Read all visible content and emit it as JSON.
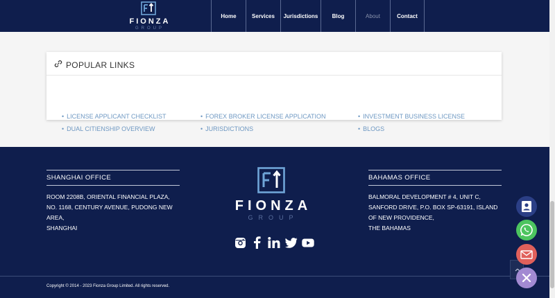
{
  "header": {
    "brand": "FIONZA",
    "brand_sub": "GROUP",
    "nav": [
      {
        "label": "Home"
      },
      {
        "label": "Services"
      },
      {
        "label": "Jurisdictions"
      },
      {
        "label": "Blog"
      },
      {
        "label": "About",
        "active": true
      },
      {
        "label": "Contact"
      }
    ]
  },
  "popular_links": {
    "title": "POPULAR LINKS",
    "icon": "link-icon",
    "items": [
      {
        "label": "LICENSE APPLICANT CHECKLIST"
      },
      {
        "label": "DUAL CITIENSHIP OVERVIEW"
      },
      {
        "label": "FOREX BROKER LICENSE APPLICATION"
      },
      {
        "label": "JURISDICTIONS"
      },
      {
        "label": "INVESTMENT BUSINESS LICENSE"
      },
      {
        "label": "BLOGS"
      }
    ]
  },
  "footer": {
    "shanghai": {
      "title": "SHANGHAI OFFICE",
      "lines": [
        "ROOM 2208B, ORIENTAL FINANCIAL PLAZA,",
        "NO. 1168, CENTURY AVENUE, PUDONG NEW",
        "AREA,",
        "SHANGHAI"
      ]
    },
    "bahamas": {
      "title": "BAHAMAS OFFICE",
      "lines": [
        "BALMORAL DEVELOPMENT # 4, UNIT C,",
        "SANFORD DRIVE, P.O. BOX SP-63191, ISLAND",
        "OF NEW PROVIDENCE,",
        "THE BAHAMAS"
      ]
    },
    "brand": "FIONZA",
    "brand_sub": "GROUP",
    "social": [
      "instagram-icon",
      "facebook-icon",
      "linkedin-icon",
      "twitter-icon",
      "youtube-icon"
    ],
    "copyright": "Copyright © 2014 - 2023 Fionza Group Limited. All rights reserved."
  },
  "floating_buttons": {
    "contact": {
      "icon": "contact-card-icon",
      "color": "#2b3f86"
    },
    "whatsapp": {
      "icon": "whatsapp-icon",
      "color": "#4cc45f"
    },
    "email": {
      "icon": "email-icon",
      "color": "#e0605b"
    },
    "close": {
      "icon": "close-icon",
      "color": "#a28ad2"
    }
  },
  "colors": {
    "navy": "#0f1e4d",
    "link": "#6e98c2",
    "content_bg": "#f5f5f5"
  }
}
